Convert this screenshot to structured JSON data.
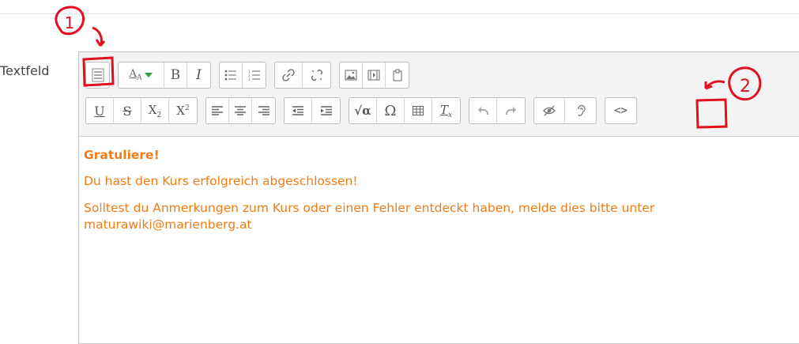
{
  "form": {
    "field_label": "Textfeld"
  },
  "toolbar": {
    "row1": [
      {
        "name": "toolbar-toggle-icon"
      },
      {
        "name": "font-color-icon",
        "label": "A",
        "sub": "A"
      },
      {
        "name": "bold-icon",
        "label": "B"
      },
      {
        "name": "italic-icon",
        "label": "I"
      },
      {
        "name": "unordered-list-icon"
      },
      {
        "name": "ordered-list-icon"
      },
      {
        "name": "link-icon"
      },
      {
        "name": "unlink-icon"
      },
      {
        "name": "image-icon"
      },
      {
        "name": "media-icon"
      },
      {
        "name": "manage-files-icon"
      }
    ],
    "row2": [
      {
        "name": "underline-icon",
        "label": "U"
      },
      {
        "name": "strikethrough-icon",
        "label": "S"
      },
      {
        "name": "subscript-icon",
        "label": "X",
        "sub": "2"
      },
      {
        "name": "superscript-icon",
        "label": "X",
        "sup": "2"
      },
      {
        "name": "align-left-icon"
      },
      {
        "name": "align-center-icon"
      },
      {
        "name": "align-right-icon"
      },
      {
        "name": "decrease-indent-icon"
      },
      {
        "name": "increase-indent-icon"
      },
      {
        "name": "equation-icon",
        "label": "√α"
      },
      {
        "name": "special-char-icon",
        "label": "Ω"
      },
      {
        "name": "table-icon"
      },
      {
        "name": "clear-formatting-icon",
        "label": "T",
        "sub": "x"
      },
      {
        "name": "undo-icon"
      },
      {
        "name": "redo-icon"
      },
      {
        "name": "accessibility-checker-icon"
      },
      {
        "name": "screenreader-helper-icon"
      },
      {
        "name": "html-source-icon",
        "label": "<>"
      }
    ]
  },
  "content": {
    "heading": "Gratuliere!",
    "line1": "Du hast den Kurs erfolgreich abgeschlossen!",
    "line2": "Solltest du Anmerkungen zum Kurs oder einen Fehler entdeckt haben, melde dies bitte unter maturawiki@marienberg.at"
  },
  "annotations": {
    "marker1": "1",
    "marker2": "2"
  },
  "colors": {
    "text_accent": "#ef7c16",
    "annotation": "#e0101e",
    "toolbar_bg": "#f3f3f3"
  }
}
